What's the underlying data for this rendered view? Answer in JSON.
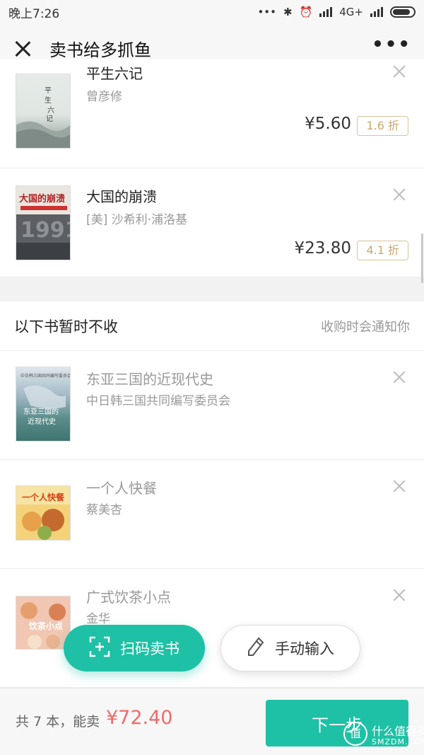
{
  "status_bar": {
    "time": "晚上7:26",
    "network": "4G+"
  },
  "header": {
    "title": "卖书给多抓鱼",
    "more_label": "•••"
  },
  "accepted_books": [
    {
      "title": "平生六记",
      "author": "曾彦修",
      "price": "¥5.60",
      "discount": "1.6 折"
    },
    {
      "title": "大国的崩溃",
      "author": "[美] 沙希利·浦洛基",
      "price": "¥23.80",
      "discount": "4.1 折"
    }
  ],
  "rejected_section": {
    "title": "以下书暂时不收",
    "note": "收购时会通知你"
  },
  "rejected_books": [
    {
      "title": "东亚三国的近现代史",
      "author": "中日韩三国共同编写委员会"
    },
    {
      "title": "一个人快餐",
      "author": "蔡美杏"
    },
    {
      "title": "广式饮茶小点",
      "author": "金华"
    }
  ],
  "actions": {
    "scan_label": "扫码卖书",
    "manual_label": "手动输入"
  },
  "footer": {
    "summary": "共 7 本，能卖",
    "total": "¥72.40",
    "next_label": "下一步"
  },
  "watermark": {
    "main": "什么值得买",
    "sub": "SMZDM.COM",
    "glyph": "值"
  },
  "colors": {
    "accent": "#1ec1a5",
    "price_highlight": "#f26a6a",
    "discount_border": "#d9c39a"
  }
}
